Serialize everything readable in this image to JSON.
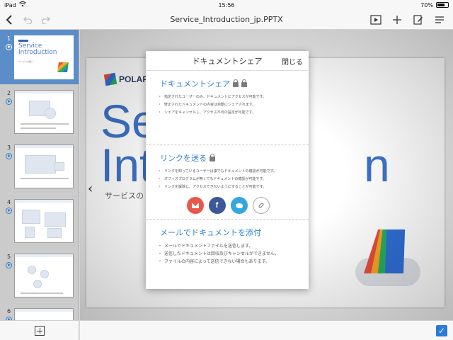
{
  "status_bar": {
    "device": "iPad",
    "wifi_icon": "wifi-icon",
    "time": "15:56",
    "battery_text": "70%",
    "battery_level": 0.7
  },
  "toolbar": {
    "title": "Service_Introduction_jp.PPTX",
    "back_icon": "back-chevron-icon",
    "undo_icon": "undo-icon",
    "redo_icon": "redo-icon",
    "play_icon": "slideshow-play-icon",
    "add_icon": "add-plus-icon",
    "format_icon": "format-icon",
    "menu_icon": "menu-list-icon"
  },
  "sidebar": {
    "slides": [
      {
        "number": "1",
        "title": "Service Introduction",
        "subtitle": "サービスの紹介"
      },
      {
        "number": "2"
      },
      {
        "number": "3"
      },
      {
        "number": "4"
      },
      {
        "number": "5"
      },
      {
        "number": "6"
      }
    ],
    "selected_index": 0,
    "add_slide_icon": "add-slide-icon"
  },
  "slide": {
    "logo_text": "POLAR",
    "big_text_line1": "Se",
    "big_text_line2": "Intr",
    "big_text_line2_tail": "n",
    "subtitle": "サービスの",
    "prev_arrow": "‹"
  },
  "popup": {
    "title": "ドキュメントシェア",
    "close_label": "閉じる",
    "section1": {
      "heading": "ドキュメントシェア",
      "bullets": [
        "指定されたユーザーのみ、ドキュメントにアクセスが可能です。",
        "修正されたドキュメントの内容は自動にシェアされます。",
        "シェアをキャンセルし、アクセス不可の設定が可能です。"
      ]
    },
    "section2": {
      "heading": "リンクを送る",
      "bullets": [
        "リンクを知っているユーザーは誰でもドキュメントの確認が可能です。",
        "オフィスプログラムが無くてもドキュメントの確認が可能です。",
        "リンクを解除し、アクセスできないようにすることが可能です。"
      ],
      "share_buttons": [
        {
          "name": "mail",
          "icon": "mail-icon",
          "color": "#e8584b"
        },
        {
          "name": "facebook",
          "label": "f",
          "color": "#3b5998"
        },
        {
          "name": "twitter",
          "icon": "twitter-icon",
          "color": "#33a8e0"
        },
        {
          "name": "link",
          "icon": "link-icon",
          "color": "#ffffff"
        }
      ]
    },
    "section3": {
      "heading": "メールでドキュメントを添付",
      "bullets": [
        "メールでドキュメントファイルを送信します。",
        "送信したドキュメントは回収及びキャンセルができません。",
        "ファイルの内容によって送信できない場合もあります。"
      ]
    }
  },
  "bottom_bar": {
    "check_icon": "checkmark-icon",
    "check_symbol": "✓"
  },
  "colors": {
    "accent_blue": "#2f7fd0",
    "sidebar_selected": "#5b8ec9",
    "slide_title_blue": "#3e72c8"
  }
}
